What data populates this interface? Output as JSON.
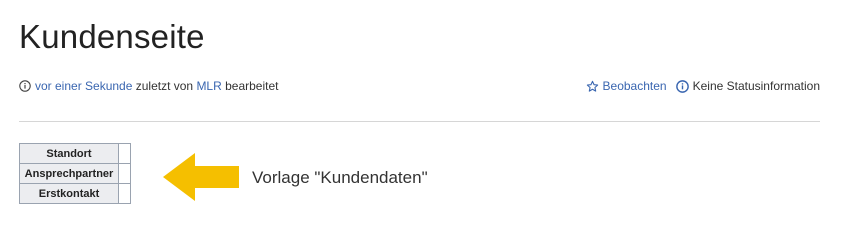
{
  "page": {
    "title": "Kundenseite"
  },
  "meta": {
    "icon": "info-circle-icon",
    "relative_time": "vor einer Sekunde",
    "edited_by_prefix": " zuletzt von ",
    "user": "MLR",
    "edited_suffix": " bearbeitet"
  },
  "actions": {
    "watch_icon": "star-outline-icon",
    "watch_label": "Beobachten",
    "status_icon": "status-info-icon",
    "status_label": "Keine Statusinformation"
  },
  "infobox": {
    "rows": [
      {
        "label": "Standort",
        "value": ""
      },
      {
        "label": "Ansprechpartner",
        "value": ""
      },
      {
        "label": "Erstkontakt",
        "value": ""
      }
    ]
  },
  "annotation": {
    "arrow_color": "#f5bf00",
    "label": "Vorlage \"Kundendaten\""
  },
  "colors": {
    "link": "#3a66b0",
    "divider": "#d6d6d6"
  }
}
